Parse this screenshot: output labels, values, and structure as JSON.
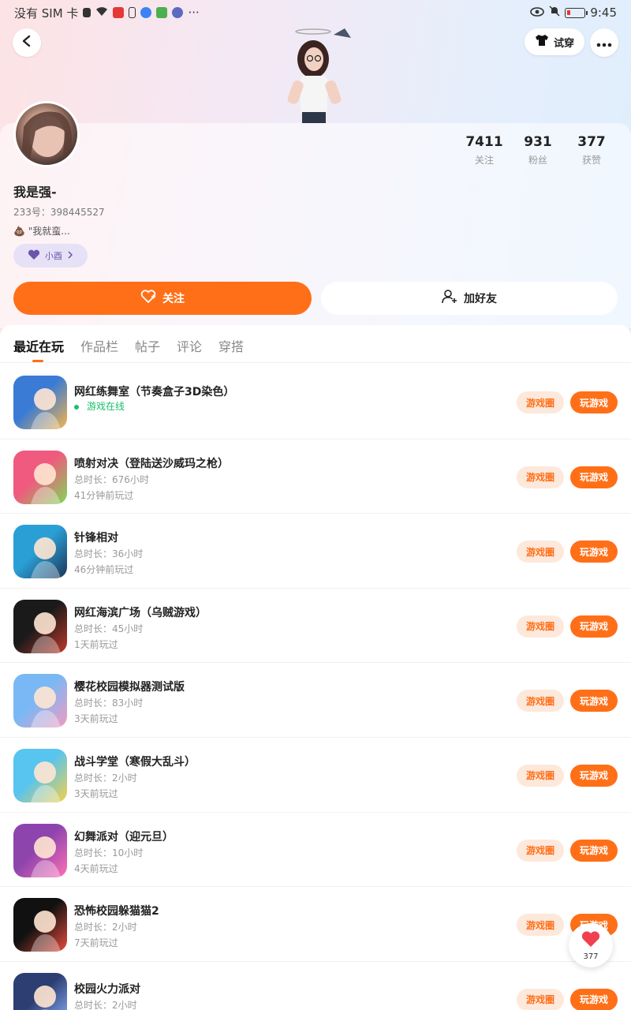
{
  "status_bar": {
    "carrier": "没有 SIM 卡",
    "time": "9:45"
  },
  "header": {
    "tryon_label": "试穿"
  },
  "profile": {
    "stats": [
      {
        "value": "7411",
        "label": "关注"
      },
      {
        "value": "931",
        "label": "粉丝"
      },
      {
        "value": "377",
        "label": "获赞"
      }
    ],
    "nickname": "我是强-",
    "uid": "233号：398445527",
    "bio": "\"我就蛮...",
    "tag": "小酉",
    "follow_label": "关注",
    "add_friend_label": "加好友"
  },
  "tabs": [
    {
      "label": "最近在玩"
    },
    {
      "label": "作品栏"
    },
    {
      "label": "帖子"
    },
    {
      "label": "评论"
    },
    {
      "label": "穿搭"
    }
  ],
  "games": [
    {
      "title": "网红练舞室（节奏盒子3D染色）",
      "sub1": "游戏在线",
      "sub2": "",
      "online": true,
      "colors": [
        "#3a7bd5",
        "#f6b44a"
      ]
    },
    {
      "title": "喷射对决（登陆送沙威玛之枪）",
      "sub1": "总时长：676小时",
      "sub2": "41分钟前玩过",
      "colors": [
        "#f05a7e",
        "#7ed957"
      ]
    },
    {
      "title": "针锋相对",
      "sub1": "总时长：36小时",
      "sub2": "46分钟前玩过",
      "colors": [
        "#2a9fd6",
        "#1d3557"
      ]
    },
    {
      "title": "网红海滨广场（乌贼游戏）",
      "sub1": "总时长：45小时",
      "sub2": "1天前玩过",
      "colors": [
        "#1a1a1a",
        "#c0392b"
      ]
    },
    {
      "title": "樱花校园模拟器测试版",
      "sub1": "总时长：83小时",
      "sub2": "3天前玩过",
      "colors": [
        "#7ab8f5",
        "#f49ac1"
      ]
    },
    {
      "title": "战斗学堂（寒假大乱斗）",
      "sub1": "总时长：2小时",
      "sub2": "3天前玩过",
      "colors": [
        "#58c4f0",
        "#f5d04b"
      ]
    },
    {
      "title": "幻舞派对（迎元旦）",
      "sub1": "总时长：10小时",
      "sub2": "4天前玩过",
      "colors": [
        "#8e44ad",
        "#ff6fb5"
      ]
    },
    {
      "title": "恐怖校园躲猫猫2",
      "sub1": "总时长：2小时",
      "sub2": "7天前玩过",
      "colors": [
        "#111111",
        "#e74c3c"
      ]
    },
    {
      "title": "校园火力派对",
      "sub1": "总时长：2小时",
      "sub2": "",
      "colors": [
        "#2c3e72",
        "#8fb3ff"
      ]
    }
  ],
  "buttons": {
    "circle_label": "游戏圈",
    "play_label": "玩游戏"
  },
  "like_float": {
    "count": "377"
  },
  "theme": {
    "accent": "#ff6f17",
    "online": "#19c06a"
  }
}
